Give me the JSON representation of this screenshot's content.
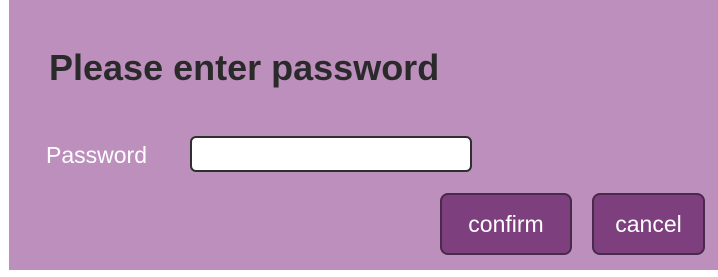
{
  "dialog": {
    "title": "Please enter password",
    "password_label": "Password",
    "password_value": "",
    "confirm_label": "confirm",
    "cancel_label": "cancel"
  },
  "colors": {
    "dialog_background": "#bd8fbd",
    "button_background": "#7d3f7d",
    "title_text": "#2a2a2a",
    "label_text": "#ffffff"
  }
}
